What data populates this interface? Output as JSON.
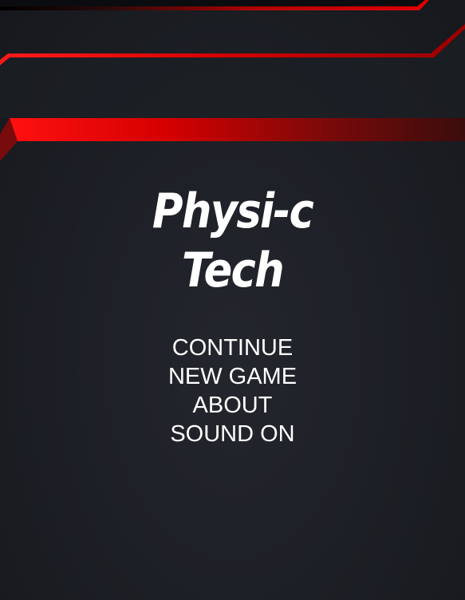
{
  "title": {
    "line1": "Physi-c",
    "line2": "Tech"
  },
  "menu": {
    "items": [
      {
        "id": "continue",
        "label": "CONTINUE"
      },
      {
        "id": "new-game",
        "label": "NEW GAME"
      },
      {
        "id": "about",
        "label": "ABOUT"
      },
      {
        "id": "sound",
        "label": "SOUND ON"
      }
    ]
  },
  "colors": {
    "background": "#1d2026",
    "accent_red": "#e50000",
    "text": "#ffffff"
  }
}
